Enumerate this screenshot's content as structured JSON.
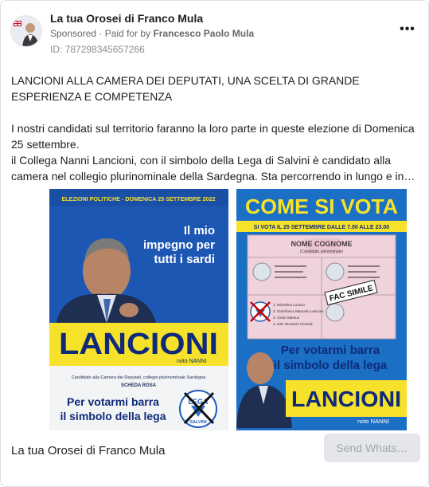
{
  "header": {
    "page_name": "La tua Orosei di Franco Mula",
    "sponsored": "Sponsored",
    "paid_prefix": "· Paid for by",
    "payer": "Francesco Paolo Mula",
    "ad_id": "ID: 787298345657266",
    "more": "•••"
  },
  "post": {
    "headline": "LANCIONI ALLA CAMERA DEI DEPUTATI, UNA SCELTA DI GRANDE ESPERIENZA E COMPETENZA",
    "paragraph1": "I nostri candidati sul territorio faranno la loro parte in queste elezione di Domenica 25 settembre.",
    "paragraph2": "il Collega Nanni Lancioni, con il simbolo della Lega di Salvini è candidato alla camera nel collegio plurinominale della Sardegna. Sta percorrendo in lungo e in…"
  },
  "poster_left": {
    "banner": "ELEZIONI POLITICHE - DOMENICA 25 SETTEMBRE 2022",
    "slogan_line1": "Il mio",
    "slogan_line2": "impegno per",
    "slogan_line3": "tutti i sardi",
    "name": "LANCIONI",
    "nickname": "noto NANNI",
    "candidacy_line1": "Candidato alla Camera dei Deputati, collegio plurinominale Sardegna",
    "candidacy_line2": "SCHEDA ROSA",
    "vote_line1": "Per votarmi barra",
    "vote_line2": "il simbolo della lega",
    "logo_top": "LEGA",
    "logo_bottom": "SALVINI"
  },
  "poster_right": {
    "title": "COME SI VOTA",
    "subtitle": "SI VOTA IL 25 SETTEMBRE DALLE 7.00 ALLE 23.00",
    "ballot_header": "NOME COGNOME",
    "ballot_sub": "(Candidato uninominale)",
    "stamp": "FAC SIMILE",
    "vote_line1": "Per votarmi barra",
    "vote_line2": "il simbolo della lega",
    "name": "LANCIONI",
    "nickname": "noto NANNI",
    "candidates": [
      "1. Michelina Lunesu",
      "2. Gianfranco Manuelo Lancioni",
      "3. Giulio Sabeus",
      "4. Ivan Giovanni Cerandi"
    ]
  },
  "footer": {
    "page_name": "La tua Orosei di Franco Mula",
    "cta": "Send Whats…"
  },
  "colors": {
    "poster_blue": "#1d57b4",
    "poster_yellow": "#f6e12b",
    "poster_dark_blue": "#0e2a79",
    "ballot_pink": "#efd2dc"
  }
}
